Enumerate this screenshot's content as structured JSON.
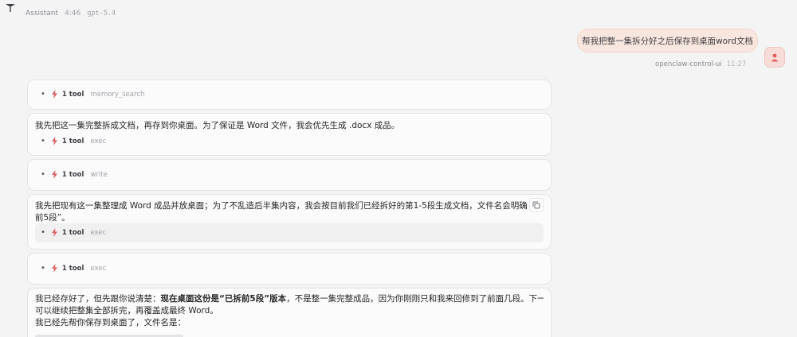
{
  "assistant": {
    "name": "Assistant",
    "time": "4:46",
    "model": "gpt-5.4"
  },
  "user_message": {
    "text": "帮我把整一集拆分好之后保存到桌面word文档",
    "sender": "openclaw-control-ui",
    "time": "11:27"
  },
  "cards": [
    {
      "tool_count": "1 tool",
      "tool_name": "memory_search"
    },
    {
      "text": "我先把这一集完整拆成文档，再存到你桌面。为了保证是 Word 文件，我会优先生成 .docx 成品。",
      "tool_count": "1 tool",
      "tool_name": "exec"
    },
    {
      "tool_count": "1 tool",
      "tool_name": "write"
    },
    {
      "text_line1": "我先把现有这一集整理成 Word 成品并放桌面；为了不乱造后半集内容，我会按目前我们已经拆好的第1-5段生成文档，文件名会明确写“已拆",
      "text_line2": "前5段”。",
      "tool_count": "1 tool",
      "tool_name": "exec"
    },
    {
      "tool_count": "1 tool",
      "tool_name": "exec"
    },
    {
      "line1_pre": "我已经存好了，但先跟你说清楚：",
      "line1_bold": "现在桌面这份是“已拆前5段”版本",
      "line1_post": "，不是整一集完整成品，因为你刚刚只和我来回修到了前面几段。下一步我",
      "line2": "可以继续把整集全部拆完，再覆盖成最终 Word。",
      "line3": "我已经先帮你保存到桌面了，文件名是："
    }
  ],
  "icons": {
    "top": "pin-icon",
    "bolt": "bolt-icon",
    "avatar": "user-icon",
    "copy": "copy-icon"
  },
  "colors": {
    "accent": "#e05d5d",
    "user_bubble": "#f8e6df",
    "background": "#f4f4f5"
  }
}
